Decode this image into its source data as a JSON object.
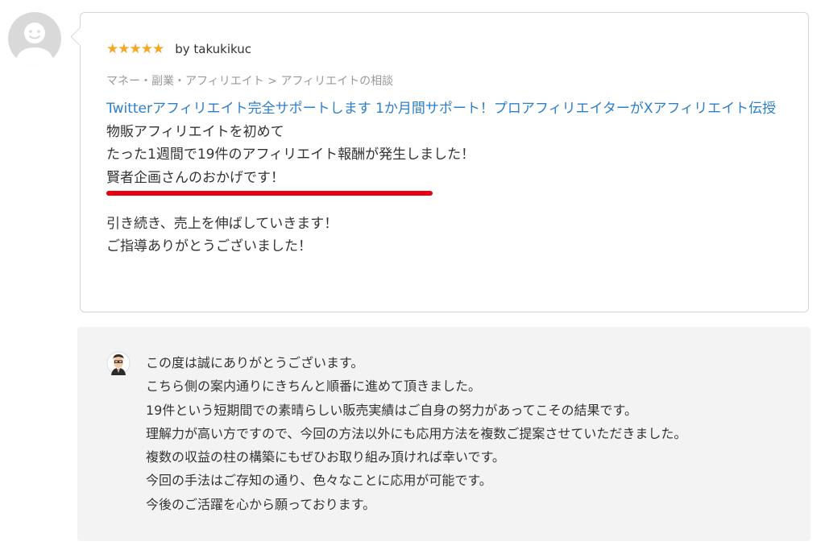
{
  "reviewer": {
    "avatar_icon": "default-user-avatar",
    "rating": 5,
    "stars": "★★★★★",
    "by_label": "by takukikuc"
  },
  "review": {
    "category": "マネー・副業・アフィリエイト > アフィリエイトの相談",
    "service_title": "Twitterアフィリエイト完全サポートします 1か月間サポート！プロアフィリエイターがXアフィリエイト伝授",
    "lines": [
      "物販アフィリエイトを初めて",
      "たった1週間で19件のアフィリエイト報酬が発生しました！",
      "賢者企画さんのおかげです！",
      "",
      "引き続き、売上を伸ばしていきます！",
      "ご指導ありがとうございました！"
    ]
  },
  "reply": {
    "seller_icon": "seller-avatar",
    "lines": [
      "この度は誠にありがとうございます。",
      "こちら側の案内通りにきちんと順番に進めて頂きました。",
      "19件という短期間での素晴らしい販売実績はご自身の努力があってこその結果です。",
      "理解力が高い方ですので、今回の方法以外にも応用方法を複数ご提案させていただきました。",
      "複数の収益の柱の構築にもぜひお取り組み頂ければ幸いです。",
      "今回の手法はご存知の通り、色々なことに応用が可能です。",
      "今後のご活躍を心から願っております。"
    ]
  },
  "colors": {
    "star": "#f5a623",
    "link": "#2d7fc9",
    "highlight_underline": "#e60012",
    "reply_bg": "#f3f3f4"
  }
}
